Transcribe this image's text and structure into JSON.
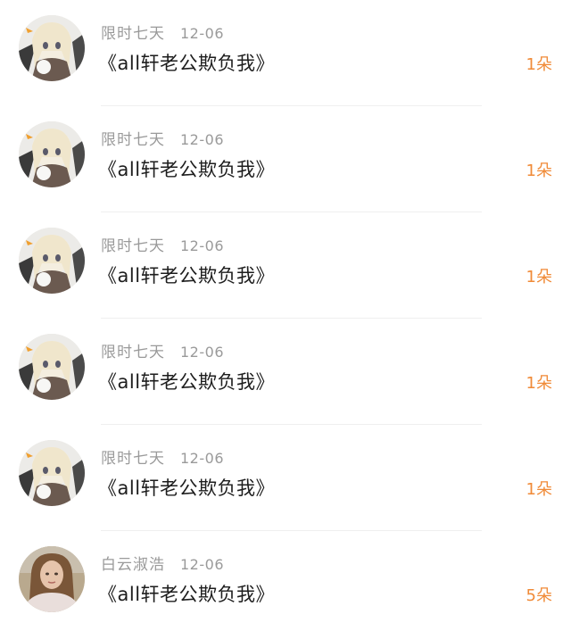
{
  "comments": [
    {
      "username": "限时七天",
      "date": "12-06",
      "title": "《all轩老公欺负我》",
      "gift": "1朵",
      "avatar": "anime-girl-avatar"
    },
    {
      "username": "限时七天",
      "date": "12-06",
      "title": "《all轩老公欺负我》",
      "gift": "1朵",
      "avatar": "anime-girl-avatar"
    },
    {
      "username": "限时七天",
      "date": "12-06",
      "title": "《all轩老公欺负我》",
      "gift": "1朵",
      "avatar": "anime-girl-avatar"
    },
    {
      "username": "限时七天",
      "date": "12-06",
      "title": "《all轩老公欺负我》",
      "gift": "1朵",
      "avatar": "anime-girl-avatar"
    },
    {
      "username": "限时七天",
      "date": "12-06",
      "title": "《all轩老公欺负我》",
      "gift": "1朵",
      "avatar": "anime-girl-avatar"
    },
    {
      "username": "白云淑浩",
      "date": "12-06",
      "title": "《all轩老公欺负我》",
      "gift": "5朵",
      "avatar": "photo-woman-avatar"
    }
  ],
  "colors": {
    "accent": "#f08a37",
    "meta": "#9a9a9a",
    "title": "#1d1d1d"
  }
}
